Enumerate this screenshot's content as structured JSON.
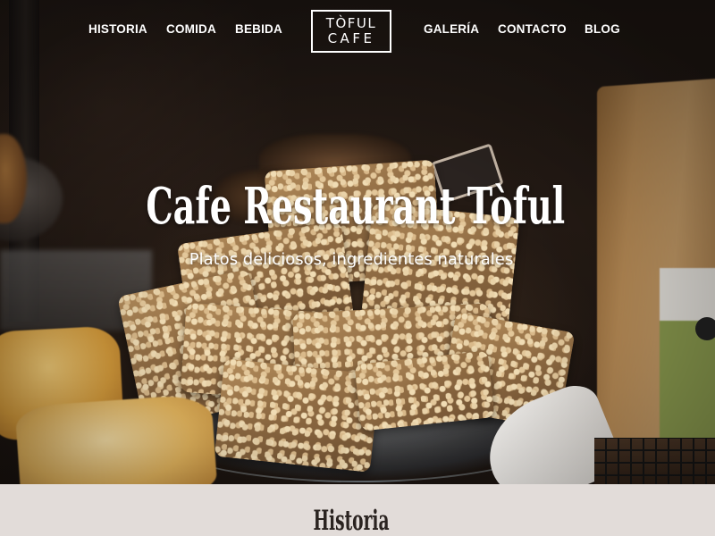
{
  "nav": {
    "left": [
      {
        "label": "HISTORIA"
      },
      {
        "label": "COMIDA"
      },
      {
        "label": "BEBIDA"
      }
    ],
    "right": [
      {
        "label": "GALERÍA"
      },
      {
        "label": "CONTACTO"
      },
      {
        "label": "BLOG"
      }
    ]
  },
  "logo": {
    "line1": "TÒFUL",
    "line2": "CAFE"
  },
  "hero": {
    "title": "Cafe Restaurant Tòful",
    "subtitle": "Platos deliciosos, ingredientes naturales"
  },
  "section": {
    "title": "Historia"
  },
  "colors": {
    "text_light": "#ffffff",
    "section_bg": "#e2dcd9",
    "section_text": "#2a2320"
  }
}
